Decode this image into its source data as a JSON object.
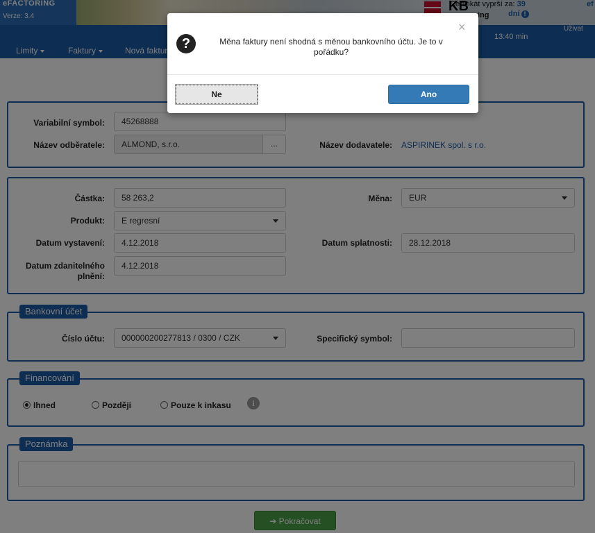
{
  "header": {
    "logo": "eFACTORING",
    "version": "Verze: 3.4",
    "bank_logo": "KB",
    "cert_text": "Certifikát vyprší za:",
    "cert_value": "39",
    "partial_ing": "ing",
    "days": "dní",
    "far_right": "ef"
  },
  "nav": {
    "items": [
      {
        "label": "Limity"
      },
      {
        "label": "Faktury"
      },
      {
        "label": "Nová faktura"
      }
    ],
    "sub_right": "13:40 min",
    "sub_right2": "Uživat"
  },
  "dialog": {
    "message": "Měna faktury není shodná s měnou bankovního účtu. Je to v pořádku?",
    "close": "×",
    "no_label": "Ne",
    "yes_label": "Ano"
  },
  "invoice": {
    "variable_symbol_label": "Variabilní symbol:",
    "variable_symbol_value": "45268888",
    "buyer_label": "Název odběratele:",
    "buyer_value": "ALMOND, s.r.o.",
    "buyer_btn": "...",
    "supplier_label": "Název dodavatele:",
    "supplier_value": "ASPIRINEK spol. s r.o."
  },
  "amounts": {
    "amount_label": "Částka:",
    "amount_value": "58 263,2",
    "currency_label": "Měna:",
    "currency_value": "EUR",
    "product_label": "Produkt:",
    "product_value": "E regresní",
    "issue_date_label": "Datum vystavení:",
    "issue_date_value": "4.12.2018",
    "due_date_label": "Datum splatnosti:",
    "due_date_value": "28.12.2018",
    "tax_date_label": "Datum zdanitelného plnění:",
    "tax_date_value": "4.12.2018"
  },
  "bank": {
    "legend": "Bankovní účet",
    "account_label": "Číslo účtu:",
    "account_value": "000000200277813 / 0300 / CZK",
    "specific_label": "Specifický symbol:",
    "specific_value": ""
  },
  "financing": {
    "legend": "Financování",
    "options": [
      {
        "label": "Ihned",
        "checked": true
      },
      {
        "label": "Později",
        "checked": false
      },
      {
        "label": "Pouze k inkasu",
        "checked": false
      }
    ],
    "info": "i"
  },
  "note": {
    "legend": "Poznámka",
    "value": ""
  },
  "continue_label": "➔ Pokračovat"
}
